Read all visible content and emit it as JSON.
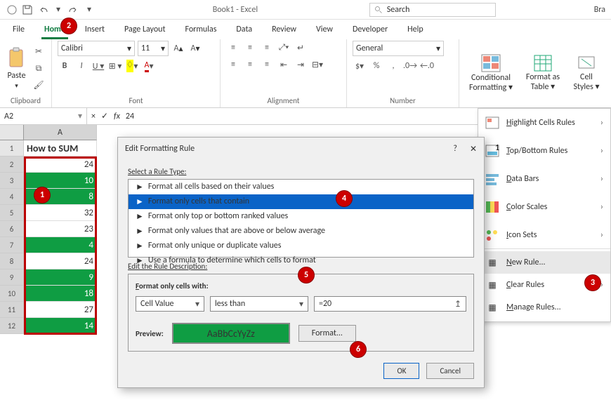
{
  "title": "Book1  -  Excel",
  "search_placeholder": "Search",
  "user_label": "Bra",
  "menu": [
    "File",
    "Home",
    "Insert",
    "Page Layout",
    "Formulas",
    "Data",
    "Review",
    "View",
    "Developer",
    "Help"
  ],
  "menu_active": 1,
  "ribbon": {
    "clipboard_label": "Clipboard",
    "paste_label": "Paste",
    "font_label": "Font",
    "font_name": "Calibri",
    "font_size": "11",
    "alignment_label": "Alignment",
    "number_label": "Number",
    "number_format": "General",
    "cond_fmt_label": "Conditional\nFormatting ▾",
    "fmt_table_label": "Format as\nTable ▾",
    "cell_styles_label": "Cell\nStyles ▾"
  },
  "namebox": "A2",
  "formula_value": "24",
  "grid": {
    "col_header": "A",
    "rows": [
      {
        "n": 1,
        "text": "How to SUM",
        "cls": "hdr"
      },
      {
        "n": 2,
        "text": "24",
        "cls": "num"
      },
      {
        "n": 3,
        "text": "10",
        "cls": "num green"
      },
      {
        "n": 4,
        "text": "8",
        "cls": "num green"
      },
      {
        "n": 5,
        "text": "32",
        "cls": "num"
      },
      {
        "n": 6,
        "text": "23",
        "cls": "num"
      },
      {
        "n": 7,
        "text": "4",
        "cls": "num green"
      },
      {
        "n": 8,
        "text": "24",
        "cls": "num"
      },
      {
        "n": 9,
        "text": "9",
        "cls": "num green"
      },
      {
        "n": 10,
        "text": "18",
        "cls": "num green"
      },
      {
        "n": 11,
        "text": "27",
        "cls": "num"
      },
      {
        "n": 12,
        "text": "14",
        "cls": "num green"
      }
    ]
  },
  "cf_menu": {
    "items": [
      {
        "label": "Highlight Cells Rules",
        "icon": "hcr",
        "arrow": true,
        "u": "H"
      },
      {
        "label": "Top/Bottom Rules",
        "icon": "tbr",
        "arrow": true,
        "u": "T"
      },
      {
        "label": "Data Bars",
        "icon": "db",
        "arrow": true,
        "u": "D"
      },
      {
        "label": "Color Scales",
        "icon": "cs",
        "arrow": true,
        "u": "S"
      },
      {
        "label": "Icon Sets",
        "icon": "is",
        "arrow": true,
        "u": "I"
      }
    ],
    "plain": [
      {
        "label": "New Rule...",
        "u": "N",
        "hover": true
      },
      {
        "label": "Clear Rules",
        "u": "C",
        "arrow": true
      },
      {
        "label": "Manage Rules...",
        "u": "R"
      }
    ]
  },
  "dialog": {
    "title": "Edit Formatting Rule",
    "select_label": "Select a Rule Type:",
    "rules": [
      "Format all cells based on their values",
      "Format only cells that contain",
      "Format only top or bottom ranked values",
      "Format only values that are above or below average",
      "Format only unique or duplicate values",
      "Use a formula to determine which cells to format"
    ],
    "rules_selected": 1,
    "edit_desc_label": "Edit the Rule Description:",
    "format_only_label": "Format only cells with:",
    "combo1": "Cell Value",
    "combo2": "less than",
    "input_val": "=20",
    "preview_label": "Preview:",
    "preview_text": "AaBbCcYyZz",
    "format_btn": "Format...",
    "ok": "OK",
    "cancel": "Cancel"
  },
  "callouts": {
    "1": "1",
    "2": "2",
    "3": "3",
    "4": "4",
    "5": "5",
    "6": "6"
  }
}
